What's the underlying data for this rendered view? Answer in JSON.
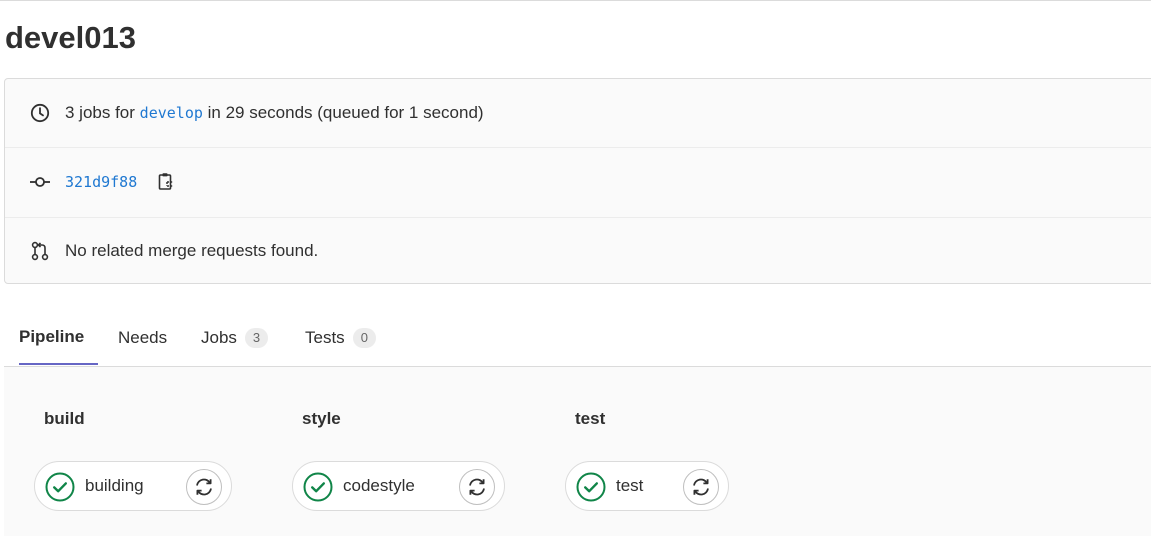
{
  "page": {
    "title": "devel013"
  },
  "info": {
    "jobs_prefix": "3 jobs for",
    "branch": "develop",
    "jobs_suffix": "in 29 seconds (queued for 1 second)",
    "commit_sha": "321d9f88",
    "merge_requests": "No related merge requests found."
  },
  "tabs": [
    {
      "label": "Pipeline",
      "active": true
    },
    {
      "label": "Needs"
    },
    {
      "label": "Jobs",
      "count": "3"
    },
    {
      "label": "Tests",
      "count": "0"
    }
  ],
  "stages": [
    {
      "title": "build",
      "job": {
        "name": "building",
        "status": "passed"
      }
    },
    {
      "title": "style",
      "job": {
        "name": "codestyle",
        "status": "passed"
      }
    },
    {
      "title": "test",
      "job": {
        "name": "test",
        "status": "passed"
      }
    }
  ],
  "colors": {
    "success": "#108548",
    "link": "#1f78d1",
    "active_tab": "#6666c4"
  },
  "icons": {
    "clock": "clock-icon",
    "commit": "commit-icon",
    "copy": "copy-to-clipboard-icon",
    "merge_request": "merge-request-icon",
    "status": "status-success-icon",
    "retry": "retry-icon"
  }
}
